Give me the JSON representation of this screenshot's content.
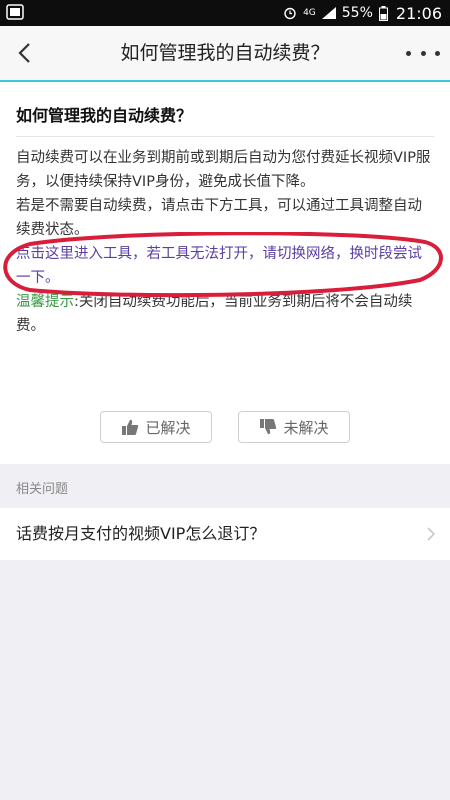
{
  "status_bar": {
    "network": "4G",
    "battery": "55%",
    "time": "21:06"
  },
  "nav": {
    "title": "如何管理我的自动续费？"
  },
  "question": {
    "title": "如何管理我的自动续费？"
  },
  "answer": {
    "para1": "自动续费可以在业务到期前或到期后自动为您付费延长视频VIP服务，以便持续保持VIP身份，避免成长值下降。",
    "para2": "若是不需要自动续费，请点击下方工具，可以通过工具调整自动续费状态。",
    "link": "点击这里进入工具，若工具无法打开，请切换网络，换时段尝试一下。",
    "tip_label": "温馨提示",
    "tip_text": ":关闭自动续费功能后，当前业务到期后将不会自动续费。"
  },
  "feedback": {
    "solved_label": "已解决",
    "unsolved_label": "未解决"
  },
  "related": {
    "header": "相关问题",
    "items": [
      {
        "label": "话费按月支付的视频VIP怎么退订？"
      }
    ]
  },
  "colors": {
    "accent_line": "#3ec7d6",
    "link": "#5b3fa3",
    "tip": "#3a9a45",
    "annotation_oval": "#d81e3a"
  }
}
